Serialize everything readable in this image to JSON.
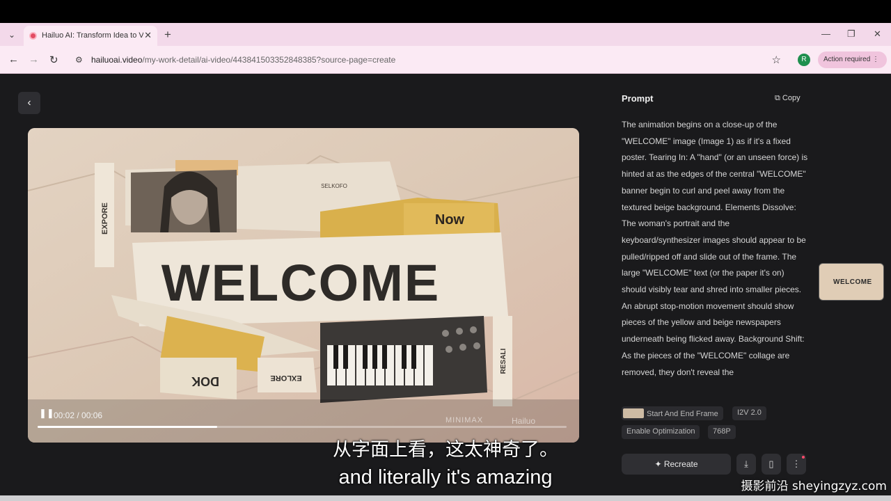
{
  "browser": {
    "tab_title": "Hailuo AI: Transform Idea to Vi",
    "url_host": "hailuoai.video",
    "url_path": "/my-work-detail/ai-video/443841503352848385?source-page=create",
    "profile_initial": "R",
    "action_required": "Action required",
    "icons": {
      "tab_list": "chevron-down-icon",
      "tab_close": "close-icon",
      "new_tab": "plus-icon",
      "back": "arrow-left-icon",
      "forward": "arrow-right-icon",
      "reload": "reload-icon",
      "site_info": "tune-icon",
      "bookmark": "star-icon",
      "menu": "more-vertical-icon"
    }
  },
  "player": {
    "poster_text": "WELCOME",
    "poster_now": "Now",
    "poster_expore": "EXPORE",
    "poster_exlore": "EXLORE",
    "poster_resali": "RESALI",
    "poster_top_stamp": "SELKOFO",
    "timecode": "00:02 / 00:06",
    "progress_fraction": 0.34,
    "watermark_left": "MINIMAX",
    "watermark_right": "Hailuo"
  },
  "panel": {
    "prompt_title": "Prompt",
    "copy_label": "Copy",
    "prompt_text": "The animation begins on a close-up of the \"WELCOME\" image (Image 1) as if it's a fixed poster. Tearing In: A \"hand\" (or an unseen force) is hinted at as the edges of the central \"WELCOME\" banner begin to curl and peel away from the textured beige background. Elements Dissolve: The woman's portrait and the keyboard/synthesizer images should appear to be pulled/ripped off and slide out of the frame. The large \"WELCOME\" text (or the paper it's on) should visibly tear and shred into smaller pieces. An abrupt stop-motion movement should show pieces of the yellow and beige newspapers underneath being flicked away. Background Shift: As the pieces of the \"WELCOME\" collage are removed, they don't reveal the",
    "chips": [
      "Start And End Frame",
      "I2V 2.0",
      "Enable Optimization",
      "768P"
    ],
    "recreate_label": "Recreate",
    "thumb_text": "WELCOME"
  },
  "overlay": {
    "subtitle_cn": "从字面上看，这太神奇了。",
    "subtitle_en": "and literally it's amazing",
    "site_watermark": "摄影前沿 sheyingzyz.com"
  }
}
